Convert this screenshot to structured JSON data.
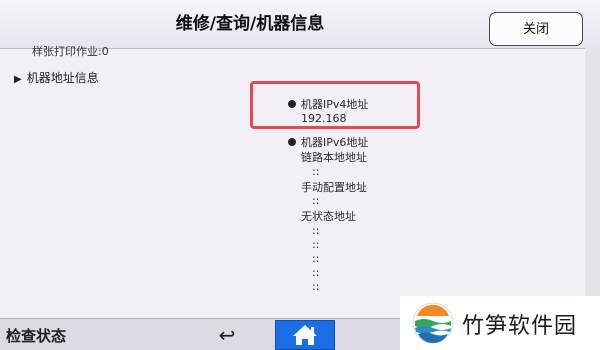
{
  "header": {
    "title": "维修/查询/机器信息",
    "close_label": "关闭"
  },
  "left": {
    "sample_print_jobs": "样张打印作业:0",
    "section_label": "机器地址信息"
  },
  "ipv4": {
    "heading": "机器IPv4地址",
    "value": "192.168"
  },
  "ipv6": {
    "heading": "机器IPv6地址",
    "link_local": "链路本地地址",
    "manual": "手动配置地址",
    "stateless": "无状态地址",
    "separator": "::"
  },
  "footer": {
    "status_label": "检查状态",
    "back_glyph": "↩"
  },
  "watermark": {
    "text": "竹笋软件园"
  },
  "colors": {
    "highlight": "#e8494f",
    "home_button": "#1b6ee6"
  }
}
